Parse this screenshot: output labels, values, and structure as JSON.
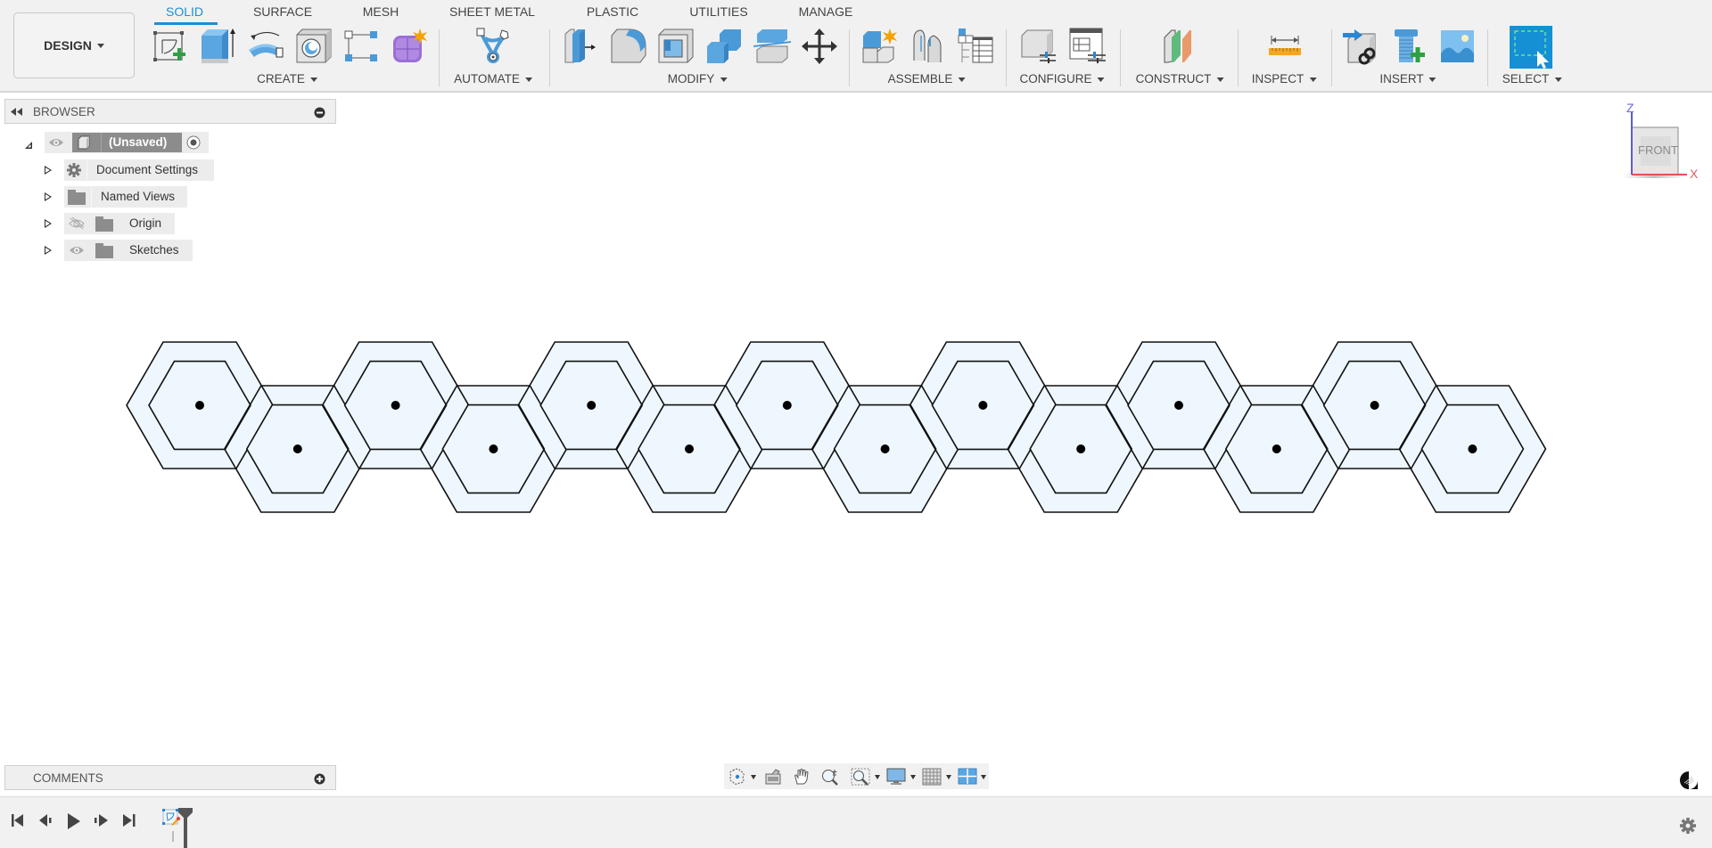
{
  "workspace": {
    "label": "DESIGN"
  },
  "tabs": [
    {
      "label": "SOLID",
      "active": true
    },
    {
      "label": "SURFACE",
      "active": false
    },
    {
      "label": "MESH",
      "active": false
    },
    {
      "label": "SHEET METAL",
      "active": false
    },
    {
      "label": "PLASTIC",
      "active": false
    },
    {
      "label": "UTILITIES",
      "active": false
    },
    {
      "label": "MANAGE",
      "active": false
    }
  ],
  "toolbar_groups": [
    {
      "label": "CREATE",
      "tools": [
        "create-sketch",
        "extrude",
        "revolve",
        "hole",
        "pattern",
        "create-form"
      ]
    },
    {
      "label": "AUTOMATE",
      "tools": [
        "automate"
      ]
    },
    {
      "label": "MODIFY",
      "tools": [
        "press-pull",
        "fillet",
        "shell",
        "combine",
        "split-body",
        "move-copy"
      ]
    },
    {
      "label": "ASSEMBLE",
      "tools": [
        "new-component",
        "joint",
        "bill-of-materials"
      ]
    },
    {
      "label": "CONFIGURE",
      "tools": [
        "configure-design",
        "configuration-table"
      ]
    },
    {
      "label": "CONSTRUCT",
      "tools": [
        "offset-plane"
      ]
    },
    {
      "label": "INSPECT",
      "tools": [
        "measure"
      ]
    },
    {
      "label": "INSERT",
      "tools": [
        "insert-derive",
        "insert-mcmaster",
        "insert-canvas"
      ]
    },
    {
      "label": "SELECT",
      "tools": [
        "window-select"
      ]
    }
  ],
  "browser": {
    "title": "BROWSER",
    "root": {
      "label": "(Unsaved)"
    },
    "items": [
      {
        "label": "Document Settings",
        "icon": "gear-icon"
      },
      {
        "label": "Named Views",
        "icon": "folder-icon"
      },
      {
        "label": "Origin",
        "icon": "folder-icon",
        "visibility": "hidden"
      },
      {
        "label": "Sketches",
        "icon": "folder-icon",
        "visibility": "visible"
      }
    ]
  },
  "comments": {
    "title": "COMMENTS"
  },
  "viewcube": {
    "face": "FRONT",
    "axis_up": "Z",
    "axis_right": "X"
  },
  "canvas": {
    "hex_count": 14,
    "fill_color": "#eef7fd",
    "stroke_color": "#111111"
  },
  "navbar": {
    "tools": [
      "orbit",
      "look-at",
      "pan",
      "zoom",
      "fit-window",
      "display-settings",
      "grid-snaps",
      "viewports"
    ]
  },
  "timeline": {
    "controls": [
      "go-to-start",
      "step-back",
      "play",
      "step-forward",
      "go-to-end"
    ],
    "features": [
      "sketch"
    ]
  }
}
